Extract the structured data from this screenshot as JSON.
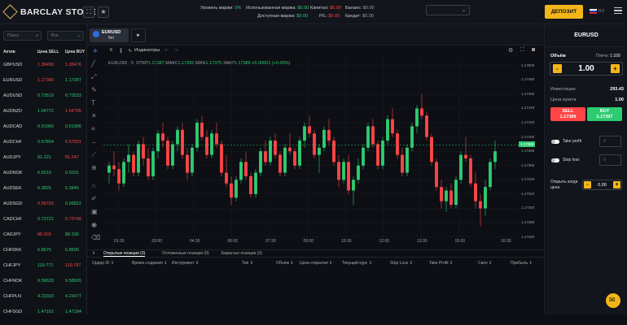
{
  "brand": {
    "name": "BARCLAY STONE"
  },
  "topbar": {
    "star_icon": "star-icon",
    "margin_level_label": "Уровень маржи:",
    "margin_level_value": "0%",
    "used_margin_label": "Использованная маржа:",
    "used_margin_value": "$0.00",
    "available_margin_label": "Доступная маржа:",
    "available_margin_value": "$0.00",
    "capital_label": "Капитал:",
    "capital_value": "$0.00",
    "pl_label": "P/L:",
    "pl_value": "$0.00",
    "balance_label": "Баланс:",
    "balance_value": "$0.00",
    "credit_label": "Кредит:",
    "credit_value": "$0.00",
    "deposit_label": "ДЕПОЗИТ",
    "lang": "RU"
  },
  "sidebar": {
    "search_placeholder": "Поиск",
    "filter_value": "Все",
    "col_asset": "Актив",
    "col_sell": "Цена SELL",
    "col_buy": "Цена BUY",
    "assets": [
      {
        "name": "GBPUSD",
        "sell": "1.38458",
        "buy": "1.38476",
        "sc": "red",
        "bc": "red"
      },
      {
        "name": "EURUSD",
        "sell": "1.17389",
        "buy": "1.17397",
        "sc": "red",
        "bc": "grn"
      },
      {
        "name": "AUDUSD",
        "sell": "0.73519",
        "buy": "0.73533",
        "sc": "grn",
        "bc": "grn"
      },
      {
        "name": "AUDNZD",
        "sell": "1.04772",
        "buy": "1.04795",
        "sc": "grn",
        "bc": "red"
      },
      {
        "name": "AUDCAD",
        "sell": "0.91965",
        "buy": "0.91996",
        "sc": "grn",
        "bc": "grn"
      },
      {
        "name": "AUDCHF",
        "sell": "0.67804",
        "buy": "0.67831",
        "sc": "grn",
        "bc": "red"
      },
      {
        "name": "AUDJPY",
        "sell": "81.221",
        "buy": "81.247",
        "sc": "grn",
        "bc": "red"
      },
      {
        "name": "AUDNOK",
        "sell": "6.5010",
        "buy": "6.5031",
        "sc": "grn",
        "bc": "grn"
      },
      {
        "name": "AUDSEK",
        "sell": "6.3825",
        "buy": "6.3845",
        "sc": "grn",
        "bc": "grn"
      },
      {
        "name": "AUDSGD",
        "sell": "0.99793",
        "buy": "0.99822",
        "sc": "red",
        "bc": "grn"
      },
      {
        "name": "CADCHF",
        "sell": "0.73721",
        "buy": "0.73748",
        "sc": "grn",
        "bc": "red"
      },
      {
        "name": "CADJPY",
        "sell": "88.303",
        "buy": "88.330",
        "sc": "red",
        "bc": "grn"
      },
      {
        "name": "CHFDKK",
        "sell": "6.8675",
        "buy": "6.8690",
        "sc": "grn",
        "bc": "grn"
      },
      {
        "name": "CHFJPY",
        "sell": "119.771",
        "buy": "119.797",
        "sc": "grn",
        "bc": "red"
      },
      {
        "name": "CHFNOK",
        "sell": "9.58633",
        "buy": "9.58826",
        "sc": "grn",
        "bc": "grn"
      },
      {
        "name": "CHFPLN",
        "sell": "4.23333",
        "buy": "4.23477",
        "sc": "grn",
        "bc": "grn"
      },
      {
        "name": "CHFSGD",
        "sell": "1.47162",
        "buy": "1.47184",
        "sc": "grn",
        "bc": "grn"
      }
    ]
  },
  "chart": {
    "tab_label": "EURUSD",
    "tab_timeframe": "5m",
    "toolbar_interval": "5",
    "indicators_label": "Индикаторы",
    "legend_symbol": "EURUSD · 5",
    "open_label": "ОТКР",
    "open_value": "1.17387",
    "high_label": "МАКС",
    "high_value": "1.17399",
    "low_label": "МИН",
    "low_value": "1.17375",
    "close_label": "ЗАКР",
    "close_value": "1.17389",
    "change_value": "+0.00003 (+0.00%)",
    "current_price": "1.17389"
  },
  "chart_data": {
    "type": "candlestick",
    "symbol": "EURUSD",
    "interval": "5m",
    "y_ticks": [
      "1.17500",
      "1.17480",
      "1.17460",
      "1.17440",
      "1.17420",
      "1.17400",
      "1.17380",
      "1.17360",
      "1.17340",
      "1.17320",
      "1.17300",
      "1.17280",
      "1.17260"
    ],
    "x_ticks": [
      "01:30",
      "03:00",
      "04:30",
      "06:00",
      "07:30",
      "09:00",
      "10:30",
      "12:00",
      "13:30",
      "15:00"
    ],
    "x_last": "16:30",
    "ylim": [
      1.17255,
      1.1751
    ],
    "candles": [
      [
        1.1735,
        1.17365,
        1.17335,
        1.1736
      ],
      [
        1.1736,
        1.1738,
        1.17345,
        1.17355
      ],
      [
        1.17355,
        1.17365,
        1.17325,
        1.17335
      ],
      [
        1.17335,
        1.1737,
        1.1733,
        1.17365
      ],
      [
        1.17365,
        1.1739,
        1.1735,
        1.17375
      ],
      [
        1.17375,
        1.1738,
        1.17345,
        1.1735
      ],
      [
        1.1735,
        1.17395,
        1.17345,
        1.1739
      ],
      [
        1.1739,
        1.174,
        1.1736,
        1.1737
      ],
      [
        1.1737,
        1.17385,
        1.1734,
        1.17345
      ],
      [
        1.17345,
        1.17385,
        1.1734,
        1.1738
      ],
      [
        1.1738,
        1.1741,
        1.1737,
        1.17405
      ],
      [
        1.17405,
        1.1742,
        1.17385,
        1.17395
      ],
      [
        1.17395,
        1.174,
        1.17355,
        1.1736
      ],
      [
        1.1736,
        1.17395,
        1.17355,
        1.1739
      ],
      [
        1.1739,
        1.17415,
        1.1738,
        1.1741
      ],
      [
        1.1741,
        1.1742,
        1.1737,
        1.17375
      ],
      [
        1.17375,
        1.17385,
        1.1734,
        1.1735
      ],
      [
        1.1735,
        1.1739,
        1.17345,
        1.17385
      ],
      [
        1.17385,
        1.17425,
        1.1738,
        1.1742
      ],
      [
        1.1742,
        1.1743,
        1.17395,
        1.174
      ],
      [
        1.174,
        1.1741,
        1.1737,
        1.17375
      ],
      [
        1.17375,
        1.1741,
        1.1737,
        1.17405
      ],
      [
        1.17405,
        1.1742,
        1.17385,
        1.1739
      ],
      [
        1.1739,
        1.17395,
        1.17345,
        1.1735
      ],
      [
        1.1735,
        1.17375,
        1.1733,
        1.17335
      ],
      [
        1.17335,
        1.17345,
        1.17305,
        1.17315
      ],
      [
        1.17315,
        1.17345,
        1.1731,
        1.1734
      ],
      [
        1.1734,
        1.1737,
        1.17335,
        1.17365
      ],
      [
        1.17365,
        1.1738,
        1.1734,
        1.17345
      ],
      [
        1.17345,
        1.1735,
        1.17315,
        1.1732
      ],
      [
        1.1732,
        1.17355,
        1.17315,
        1.1735
      ],
      [
        1.1735,
        1.17385,
        1.17345,
        1.1738
      ],
      [
        1.1738,
        1.17395,
        1.1736,
        1.17365
      ],
      [
        1.17365,
        1.174,
        1.1736,
        1.17395
      ],
      [
        1.17395,
        1.17405,
        1.1737,
        1.17375
      ],
      [
        1.17375,
        1.1738,
        1.17345,
        1.1735
      ],
      [
        1.1735,
        1.1739,
        1.17345,
        1.17385
      ],
      [
        1.17385,
        1.17405,
        1.17375,
        1.1738
      ],
      [
        1.1738,
        1.17385,
        1.17355,
        1.1736
      ],
      [
        1.1736,
        1.174,
        1.17355,
        1.17395
      ],
      [
        1.17395,
        1.1742,
        1.17385,
        1.17415
      ],
      [
        1.17415,
        1.1743,
        1.174,
        1.17405
      ],
      [
        1.17405,
        1.1741,
        1.1737,
        1.17375
      ],
      [
        1.17375,
        1.1739,
        1.1735,
        1.17385
      ],
      [
        1.17385,
        1.17415,
        1.1738,
        1.1741
      ],
      [
        1.1741,
        1.17425,
        1.1739,
        1.17395
      ],
      [
        1.17395,
        1.174,
        1.1736,
        1.17365
      ],
      [
        1.17365,
        1.17375,
        1.1733,
        1.1734
      ],
      [
        1.1734,
        1.1737,
        1.17335,
        1.17365
      ],
      [
        1.17365,
        1.17375,
        1.1732,
        1.17325
      ],
      [
        1.17325,
        1.17345,
        1.17305,
        1.1734
      ],
      [
        1.1734,
        1.1737,
        1.17335,
        1.1736
      ],
      [
        1.1736,
        1.1739,
        1.17355,
        1.17385
      ],
      [
        1.17385,
        1.1742,
        1.1738,
        1.17415
      ],
      [
        1.17415,
        1.17425,
        1.17385,
        1.1739
      ],
      [
        1.1739,
        1.17395,
        1.17355,
        1.1736
      ],
      [
        1.1736,
        1.174,
        1.17355,
        1.17395
      ],
      [
        1.17395,
        1.1743,
        1.1739,
        1.17425
      ],
      [
        1.17425,
        1.1744,
        1.174,
        1.17405
      ],
      [
        1.17405,
        1.1741,
        1.1737,
        1.17375
      ],
      [
        1.17375,
        1.17385,
        1.17345,
        1.1735
      ],
      [
        1.1735,
        1.1739,
        1.17345,
        1.17385
      ],
      [
        1.17385,
        1.1742,
        1.1738,
        1.17415
      ],
      [
        1.17415,
        1.17445,
        1.17405,
        1.1744
      ],
      [
        1.1744,
        1.1746,
        1.17425,
        1.1743
      ],
      [
        1.1743,
        1.17435,
        1.17395,
        1.174
      ],
      [
        1.174,
        1.17405,
        1.1736,
        1.17365
      ],
      [
        1.17365,
        1.1737,
        1.17325,
        1.1733
      ],
      [
        1.1733,
        1.1734,
        1.173,
        1.1731
      ],
      [
        1.1731,
        1.1733,
        1.17295,
        1.17325
      ],
      [
        1.17325,
        1.17335,
        1.173,
        1.17305
      ],
      [
        1.17305,
        1.17345,
        1.173,
        1.1734
      ],
      [
        1.1734,
        1.1738,
        1.17335,
        1.17375
      ],
      [
        1.17375,
        1.174,
        1.17365,
        1.1737
      ],
      [
        1.1737,
        1.17375,
        1.1733,
        1.17335
      ],
      [
        1.17335,
        1.1735,
        1.173,
        1.1731
      ],
      [
        1.1731,
        1.1732,
        1.17275,
        1.173
      ],
      [
        1.173,
        1.1734,
        1.1729,
        1.1733
      ],
      [
        1.1733,
        1.1737,
        1.17325,
        1.17365
      ],
      [
        1.17365,
        1.17395,
        1.17355,
        1.1738
      ]
    ]
  },
  "positions": {
    "tab_open": "Открытые позиции (0)",
    "tab_pending": "Отложенные позиции (0)",
    "tab_closed": "Закрытые позиции (0)",
    "cols": [
      "Ордер ID ⇕",
      "Время создания ⇕",
      "Инструмент ⇕",
      "Тип ⇕",
      "Объём ⇕",
      "Цена открытия ⇕",
      "Текущий курс ⇕",
      "Stop Loss ⇕",
      "Take Profit ⇕",
      "Своп ⇕",
      "Прибыль ⇕"
    ]
  },
  "trade": {
    "symbol": "EURUSD",
    "volume_label": "Объём",
    "leverage_label": "Плечо:",
    "leverage_value": "1:100",
    "minus": "-",
    "plus": "+",
    "volume_value": "1.00",
    "investment_label": "Инвестиции",
    "investment_value": "293.43",
    "pip_label": "Цена пункта",
    "pip_value": "1.00",
    "sell_label": "SELL",
    "sell_price": "1.17389",
    "buy_label": "BUY",
    "buy_price": "1.17397",
    "take_profit_label": "Take profit",
    "stop_loss_label": "Stop loss",
    "tp_value": "0",
    "sl_value": "0",
    "open_when_label": "Открыть когда цена",
    "open_when_value": "0.00"
  },
  "colors": {
    "accent": "#f2b619",
    "up": "#2ecc71",
    "down": "#ff4545",
    "bg": "#0d0f14"
  }
}
